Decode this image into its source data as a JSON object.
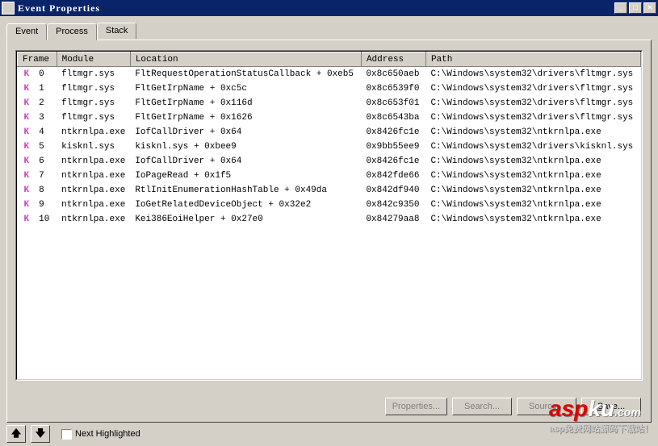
{
  "window": {
    "title": "Event Properties"
  },
  "tabs": [
    {
      "label": "Event",
      "active": false
    },
    {
      "label": "Process",
      "active": false
    },
    {
      "label": "Stack",
      "active": true
    }
  ],
  "columns": {
    "k": "",
    "frame": "Frame",
    "module": "Module",
    "location": "Location",
    "address": "Address",
    "path": "Path"
  },
  "rows": [
    {
      "k": "K",
      "frame": "0",
      "module": "fltmgr.sys",
      "location": "FltRequestOperationStatusCallback + 0xeb5",
      "address": "0x8c650aeb",
      "path": "C:\\Windows\\system32\\drivers\\fltmgr.sys"
    },
    {
      "k": "K",
      "frame": "1",
      "module": "fltmgr.sys",
      "location": "FltGetIrpName + 0xc5c",
      "address": "0x8c6539f0",
      "path": "C:\\Windows\\system32\\drivers\\fltmgr.sys"
    },
    {
      "k": "K",
      "frame": "2",
      "module": "fltmgr.sys",
      "location": "FltGetIrpName + 0x116d",
      "address": "0x8c653f01",
      "path": "C:\\Windows\\system32\\drivers\\fltmgr.sys"
    },
    {
      "k": "K",
      "frame": "3",
      "module": "fltmgr.sys",
      "location": "FltGetIrpName + 0x1626",
      "address": "0x8c6543ba",
      "path": "C:\\Windows\\system32\\drivers\\fltmgr.sys"
    },
    {
      "k": "K",
      "frame": "4",
      "module": "ntkrnlpa.exe",
      "location": "IofCallDriver + 0x64",
      "address": "0x8426fc1e",
      "path": "C:\\Windows\\system32\\ntkrnlpa.exe"
    },
    {
      "k": "K",
      "frame": "5",
      "module": "kisknl.sys",
      "location": "kisknl.sys + 0xbee9",
      "address": "0x9bb55ee9",
      "path": "C:\\Windows\\system32\\drivers\\kisknl.sys"
    },
    {
      "k": "K",
      "frame": "6",
      "module": "ntkrnlpa.exe",
      "location": "IofCallDriver + 0x64",
      "address": "0x8426fc1e",
      "path": "C:\\Windows\\system32\\ntkrnlpa.exe"
    },
    {
      "k": "K",
      "frame": "7",
      "module": "ntkrnlpa.exe",
      "location": "IoPageRead + 0x1f5",
      "address": "0x842fde66",
      "path": "C:\\Windows\\system32\\ntkrnlpa.exe"
    },
    {
      "k": "K",
      "frame": "8",
      "module": "ntkrnlpa.exe",
      "location": "RtlInitEnumerationHashTable + 0x49da",
      "address": "0x842df940",
      "path": "C:\\Windows\\system32\\ntkrnlpa.exe"
    },
    {
      "k": "K",
      "frame": "9",
      "module": "ntkrnlpa.exe",
      "location": "IoGetRelatedDeviceObject + 0x32e2",
      "address": "0x842c9350",
      "path": "C:\\Windows\\system32\\ntkrnlpa.exe"
    },
    {
      "k": "K",
      "frame": "10",
      "module": "ntkrnlpa.exe",
      "location": "Kei386EoiHelper + 0x27e0",
      "address": "0x84279aa8",
      "path": "C:\\Windows\\system32\\ntkrnlpa.exe"
    }
  ],
  "buttons": {
    "properties": "Properties...",
    "search": "Search...",
    "source": "Source...",
    "save": "Save..."
  },
  "bottom": {
    "next_highlighted": "Next Highlighted"
  },
  "save_underline": "S",
  "save_rest": "ave...",
  "next_underline": "N",
  "next_rest": "ext Highlighted"
}
